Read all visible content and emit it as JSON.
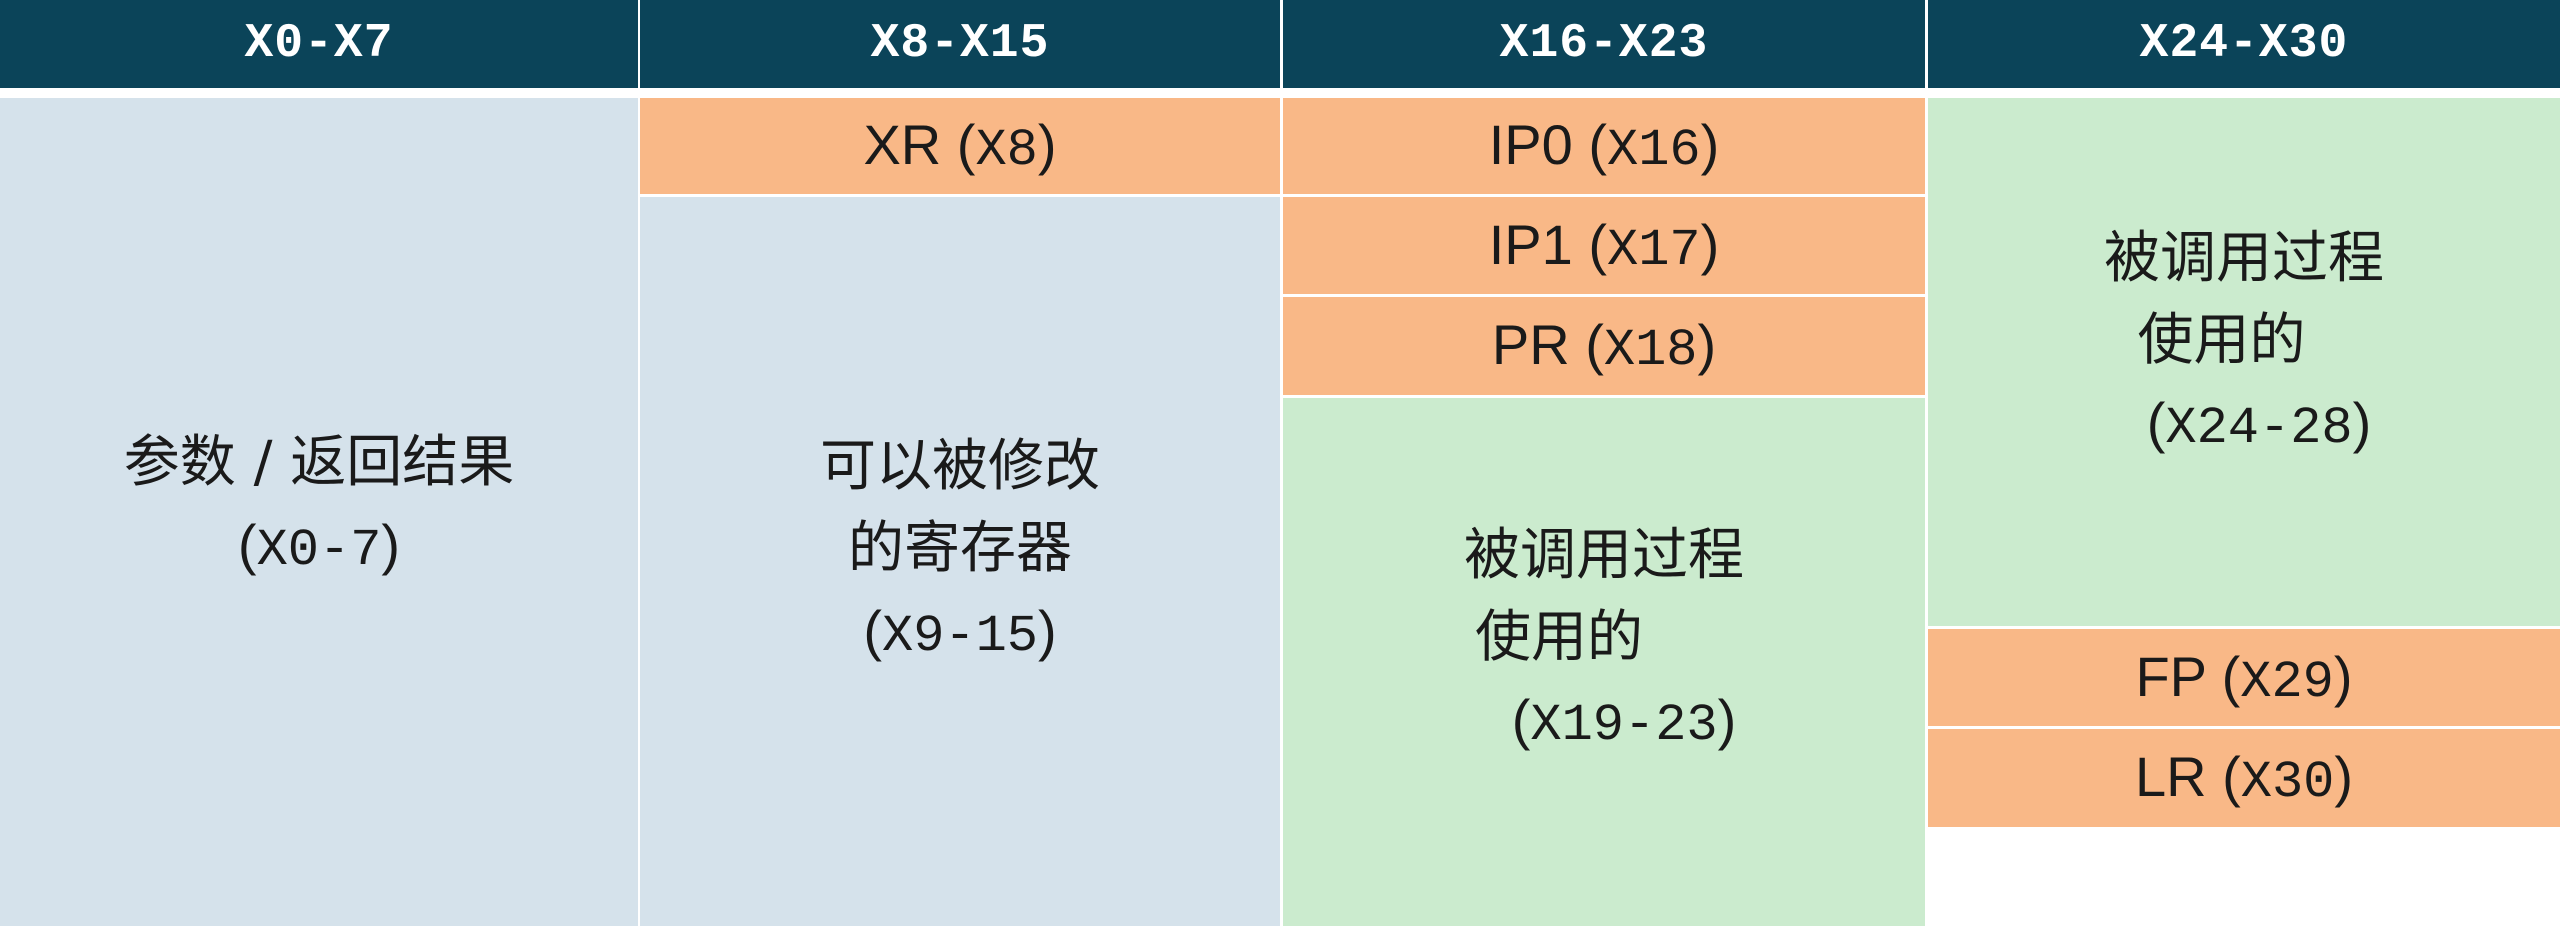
{
  "header": {
    "col1": "X0-X7",
    "col2": "X8-X15",
    "col3": "X16-X23",
    "col4": "X24-X30"
  },
  "col1": {
    "title": "参数 / 返回结果",
    "range": "X0-7"
  },
  "col2": {
    "xr": {
      "name": "XR",
      "reg": "X8"
    },
    "block": {
      "title": "可以被修改的寄存器",
      "range": "X9-15"
    }
  },
  "col3": {
    "ip0": {
      "name": "IP0",
      "reg": "X16"
    },
    "ip1": {
      "name": "IP1",
      "reg": "X17"
    },
    "pr": {
      "name": "PR",
      "reg": "X18"
    },
    "block": {
      "line1": "被调用过程",
      "line2": "使用的",
      "range": "X19-23"
    }
  },
  "col4": {
    "block": {
      "line1": "被调用过程",
      "line2": "使用的",
      "range": "X24-28"
    },
    "fp": {
      "name": "FP",
      "reg": "X29"
    },
    "lr": {
      "name": "LR",
      "reg": "X30"
    }
  },
  "colors": {
    "header_bg": "#0b4459",
    "arg_blue": "#d5e2eb",
    "special_orange": "#f9b887",
    "callee_green": "#cbebce"
  }
}
